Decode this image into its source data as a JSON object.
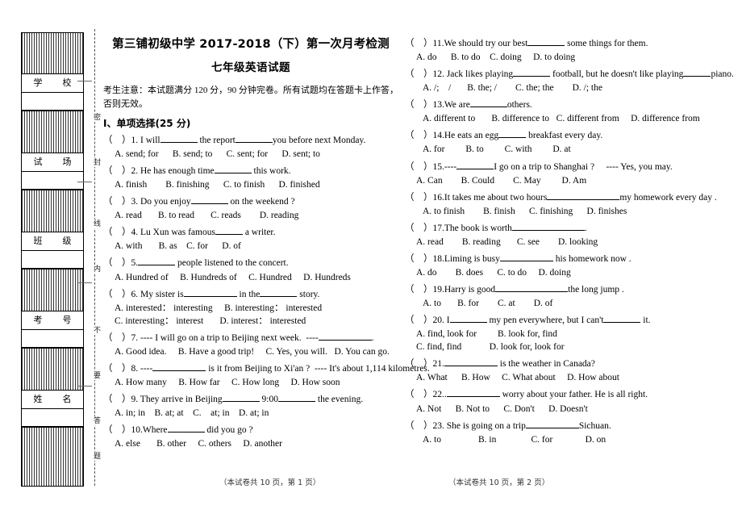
{
  "header": {
    "title": "第三铺初级中学 2017-2018（下）第一次月考检测",
    "subtitle": "七年级英语试题",
    "notice": "考生注意：本试题满分 120 分，90 分钟完卷。所有试题均在答题卡上作答，否则无效。",
    "section_heading": "I、单项选择(25 分)"
  },
  "seal": {
    "fields": [
      {
        "label": "学　校"
      },
      {
        "label": "试　场"
      },
      {
        "label": "班　级"
      },
      {
        "label": "考　号"
      },
      {
        "label": "姓　名"
      }
    ],
    "vertical_caption_1": "密",
    "vertical_caption_2": "封",
    "vertical_caption_3": "线",
    "vertical_caption_4": "内",
    "vertical_caption_5": "不",
    "vertical_caption_6": "要",
    "vertical_caption_7": "答",
    "vertical_caption_8": "题"
  },
  "footers": {
    "left": "（本试卷共 10 页，第 1 页）",
    "right": "（本试卷共 10 页，第 2 页）"
  },
  "questions_left": [
    {
      "num": "1.",
      "stem_a": "I will",
      "stem_b": "the report",
      "stem_c": "you before next Monday.",
      "opts": [
        "A. send; for",
        "B. send; to",
        "C. sent; for",
        "D. sent; to"
      ]
    },
    {
      "num": "2.",
      "stem_a": "He has enough time",
      "stem_b": "this work.",
      "opts": [
        "A. finish",
        "B. finishing",
        "C. to finish",
        "D. finished"
      ]
    },
    {
      "num": "3.",
      "stem_a": "Do you enjoy",
      "stem_b": "on the weekend ?",
      "opts": [
        "A. read",
        "B. to read",
        "C. reads",
        "D. reading"
      ]
    },
    {
      "num": "4.",
      "stem_a": "Lu Xun was famous",
      "stem_b": "a writer.",
      "opts": [
        "A. with",
        "B. as",
        "C. for",
        "D. of"
      ]
    },
    {
      "num": "5.",
      "stem_a": "",
      "stem_b": "people listened to the concert.",
      "opts": [
        "A. Hundred of",
        "B. Hundreds of",
        "C. Hundred",
        "D. Hundreds"
      ]
    },
    {
      "num": "6.",
      "stem_a": "My sister is",
      "stem_b": "in the",
      "stem_c": "story.",
      "opts_row1": [
        "A. interested：  interesting",
        "B. interesting：  interested"
      ],
      "opts_row2": [
        "C. interesting：  interest",
        "D. interest：  interested"
      ]
    },
    {
      "num": "7.",
      "stem_a": "---- I will go on a trip to Beijing next week.",
      "stem_b": "----",
      "stem_c": ".",
      "opts": [
        "A. Good idea.",
        "B. Have a good trip!",
        "C. Yes, you will.",
        "D. You can go."
      ]
    },
    {
      "num": "8.",
      "stem_a": "----",
      "stem_b": "is it from Beijing to Xi'an ?",
      "stem_c": "---- It's about 1,114 kilometres.",
      "opts": [
        "A. How many",
        "B. How far",
        "C. How long",
        "D. How soon"
      ]
    },
    {
      "num": "9.",
      "stem_a": "They arrive in Beijing",
      "stem_b": "9:00",
      "stem_c": "the evening.",
      "opts": [
        "A. in; in",
        "B. at; at",
        "C.　at; in",
        "D. at; in"
      ]
    },
    {
      "num": "10.",
      "stem_a": "Where",
      "stem_b": "did you go ?",
      "opts": [
        "A. else",
        "B. other",
        "C. others",
        "D. another"
      ]
    }
  ],
  "questions_right": [
    {
      "num": "11.",
      "stem_a": "We should try our best",
      "stem_b": "some things for them.",
      "opts": [
        "A. do",
        "B. to do",
        "C. doing",
        "D. to doing"
      ]
    },
    {
      "num": "12.",
      "stem_a": "Jack likes playing",
      "stem_b": "football, but he doesn't like playing",
      "stem_c": "piano.",
      "opts": [
        "A. /;　/",
        "B. the; /",
        "C. the; the",
        "D. /; the"
      ]
    },
    {
      "num": "13.",
      "stem_a": "We are",
      "stem_b": "others.",
      "opts": [
        "A. different to",
        "B. difference to",
        "C. different from",
        "D. difference from"
      ]
    },
    {
      "num": "14.",
      "stem_a": "He eats an egg",
      "stem_b": "breakfast every day.",
      "opts": [
        "A. for",
        "B. to",
        "C. with",
        "D. at"
      ]
    },
    {
      "num": "15.",
      "stem_a": "----",
      "stem_b": "I go on a trip to Shanghai ?",
      "stem_c": "---- Yes, you may.",
      "opts": [
        "A. Can",
        "B. Could",
        "C. May",
        "D. Am"
      ]
    },
    {
      "num": "16.",
      "stem_a": "It takes me about two hours",
      "stem_b": "my homework every day .",
      "opts": [
        "A. to finish",
        "B. finish",
        "C. finishing",
        "D. finishes"
      ]
    },
    {
      "num": "17.",
      "stem_a": "The book is worth",
      "stem_b": ".",
      "opts": [
        "A. read",
        "B. reading",
        "C. see",
        "D. looking"
      ]
    },
    {
      "num": "18.",
      "stem_a": "Liming is busy",
      "stem_b": "his homework now .",
      "opts": [
        "A. do",
        "B. does",
        "C. to do",
        "D. doing"
      ]
    },
    {
      "num": "19.",
      "stem_a": "Harry is good",
      "stem_b": "the long jump .",
      "opts": [
        "A. to",
        "B. for",
        "C. at",
        "D. of"
      ]
    },
    {
      "num": "20.",
      "stem_a": "I",
      "stem_b": "my pen everywhere, but I can't",
      "stem_c": "it.",
      "opts_row1": [
        "A. find, look for",
        "B. look for, find"
      ],
      "opts_row2": [
        "C. find, find",
        "D. look for, look for"
      ]
    },
    {
      "num": "21.",
      "stem_a": "",
      "stem_b": "is the weather in Canada?",
      "opts": [
        "A. What",
        "B. How",
        "C. What about",
        "D. How about"
      ]
    },
    {
      "num": "22.",
      "stem_a": ".",
      "stem_b": "worry about your father. He is all right.",
      "opts": [
        "A. Not",
        "B. Not to",
        "C. Don't",
        "D. Doesn't"
      ]
    },
    {
      "num": "23.",
      "stem_a": "She is going on a trip",
      "stem_b": "Sichuan.",
      "opts": [
        "A. to",
        "B. in",
        "C. for",
        "D. on"
      ]
    }
  ]
}
